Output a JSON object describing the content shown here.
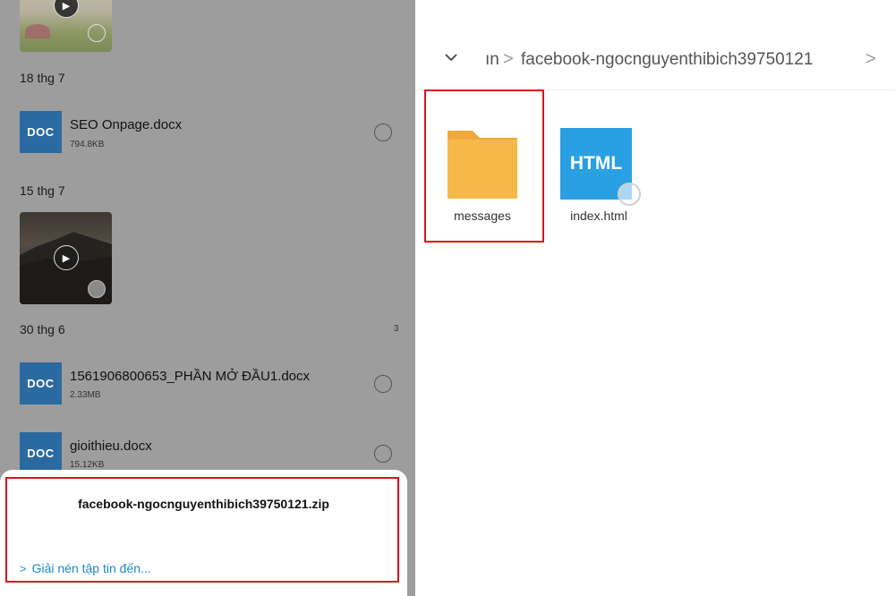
{
  "left_panel": {
    "groups": [
      {
        "date": "18 thg 7"
      },
      {
        "date": "15 thg 7"
      },
      {
        "date": "30 thg 6",
        "count": "3"
      }
    ],
    "files": [
      {
        "icon_text": "DOC",
        "name": "SEO Onpage.docx",
        "size": "794.8KB"
      },
      {
        "icon_text": "DOC",
        "name": "1561906800653_PHẦN MỞ ĐẦU1.docx",
        "size": "2.33MB"
      },
      {
        "icon_text": "DOC",
        "name": "gioithieu.docx",
        "size": "15.12KB"
      }
    ],
    "sheet": {
      "title": "facebook-ngocnguyenthibich39750121.zip",
      "extract_link": "Giải nén tập tin đến..."
    }
  },
  "right_panel": {
    "breadcrumb": {
      "prev": "ın",
      "current": "facebook-ngocnguyenthibich39750121"
    },
    "items": [
      {
        "label": "messages",
        "type": "folder"
      },
      {
        "label": "index.html",
        "type": "html",
        "icon_text": "HTML"
      }
    ]
  },
  "colors": {
    "highlight": "#d8141d",
    "doc_icon": "#2a6aa0",
    "html_icon": "#2b9fe4",
    "folder": "#f7b84a",
    "link": "#1e88c8"
  }
}
